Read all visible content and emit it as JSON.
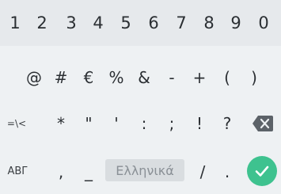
{
  "row1": [
    "1",
    "2",
    "3",
    "4",
    "5",
    "6",
    "7",
    "8",
    "9",
    "0"
  ],
  "row2": [
    "@",
    "#",
    "€",
    "%",
    "&",
    "-",
    "+",
    "(",
    ")"
  ],
  "row3": {
    "switch_label": "=\\<",
    "keys": [
      "*",
      "\"",
      "'",
      ":",
      ";",
      "!",
      "?"
    ]
  },
  "row4": {
    "abc_label": "ΑΒΓ",
    "comma": ",",
    "underscore": "_",
    "space_label": "Ελληνικά",
    "slash": "/",
    "period": "."
  },
  "colors": {
    "enter": "#3ec28f",
    "delete": "#5c6268"
  }
}
